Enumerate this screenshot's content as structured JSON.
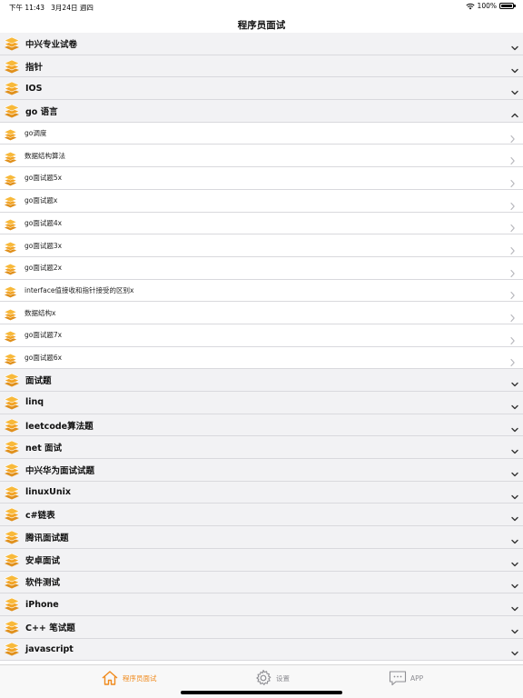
{
  "status": {
    "time": "下午 11:43",
    "date": "3月24日 週四",
    "battery": "100%",
    "battery_level": 1.0
  },
  "nav": {
    "title": "程序员面试"
  },
  "list": {
    "rows": [
      {
        "kind": "section",
        "label": "中兴专业试卷",
        "expanded": false
      },
      {
        "kind": "section",
        "label": "指针",
        "expanded": false
      },
      {
        "kind": "section",
        "label": "IOS",
        "expanded": false
      },
      {
        "kind": "section",
        "label": "go 语言",
        "expanded": true
      },
      {
        "kind": "child",
        "label": "go调度"
      },
      {
        "kind": "child",
        "label": "数据结构算法"
      },
      {
        "kind": "child",
        "label": "go面试题5x"
      },
      {
        "kind": "child",
        "label": "go面试题x"
      },
      {
        "kind": "child",
        "label": "go面试题4x"
      },
      {
        "kind": "child",
        "label": "go面试题3x"
      },
      {
        "kind": "child",
        "label": "go面试题2x"
      },
      {
        "kind": "child",
        "label": "interface值接收和指针接受的区别x"
      },
      {
        "kind": "child",
        "label": "数据结构x"
      },
      {
        "kind": "child",
        "label": "go面试题7x"
      },
      {
        "kind": "child",
        "label": "go面试题6x"
      },
      {
        "kind": "section",
        "label": "面试题",
        "expanded": false
      },
      {
        "kind": "section",
        "label": "linq",
        "expanded": false
      },
      {
        "kind": "section",
        "label": "leetcode算法题",
        "expanded": false
      },
      {
        "kind": "section",
        "label": "net 面试",
        "expanded": false
      },
      {
        "kind": "section",
        "label": "中兴华为面试试题",
        "expanded": false
      },
      {
        "kind": "section",
        "label": "linuxUnix",
        "expanded": false
      },
      {
        "kind": "section",
        "label": "c#链表",
        "expanded": false
      },
      {
        "kind": "section",
        "label": "腾讯面试题",
        "expanded": false
      },
      {
        "kind": "section",
        "label": "安卓面试",
        "expanded": false
      },
      {
        "kind": "section",
        "label": "软件测试",
        "expanded": false
      },
      {
        "kind": "section",
        "label": "iPhone",
        "expanded": false
      },
      {
        "kind": "section",
        "label": "C++ 笔试题",
        "expanded": false
      },
      {
        "kind": "section",
        "label": "javascript",
        "expanded": false
      }
    ]
  },
  "tabs": [
    {
      "label": "程序员面试",
      "icon": "home-icon",
      "active": true
    },
    {
      "label": "设置",
      "icon": "gear-icon",
      "active": false
    },
    {
      "label": "APP",
      "icon": "chat-bubble-icon",
      "active": false
    }
  ],
  "colors": {
    "accent": "#f08a1c",
    "inactive": "#8e8e93",
    "section_bg": "#f2f2f4"
  }
}
